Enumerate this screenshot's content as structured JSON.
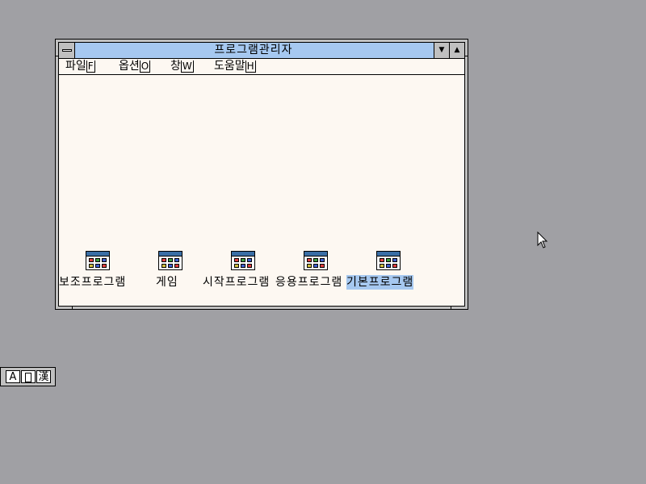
{
  "window": {
    "title": "프로그램관리자",
    "minimize_glyph": "▼",
    "maximize_glyph": "▲"
  },
  "menu": [
    {
      "label": "파일",
      "key": "F"
    },
    {
      "label": "옵션",
      "key": "O"
    },
    {
      "label": "창",
      "key": "W"
    },
    {
      "label": "도움말",
      "key": "H"
    }
  ],
  "groups": [
    {
      "label": "보조프로그램",
      "selected": false
    },
    {
      "label": "게임",
      "selected": false
    },
    {
      "label": "시작프로그램",
      "selected": false
    },
    {
      "label": "응용프로그램",
      "selected": false
    },
    {
      "label": "기본프로그램",
      "selected": true
    }
  ],
  "ime": {
    "mode_a": "A",
    "mode_b": "",
    "mode_c": "漢"
  },
  "colors": {
    "desktop": "#a0a0a4",
    "title_active": "#a6c8f0",
    "selection": "#a6c8f0",
    "window_bg": "#fdf8f2"
  }
}
